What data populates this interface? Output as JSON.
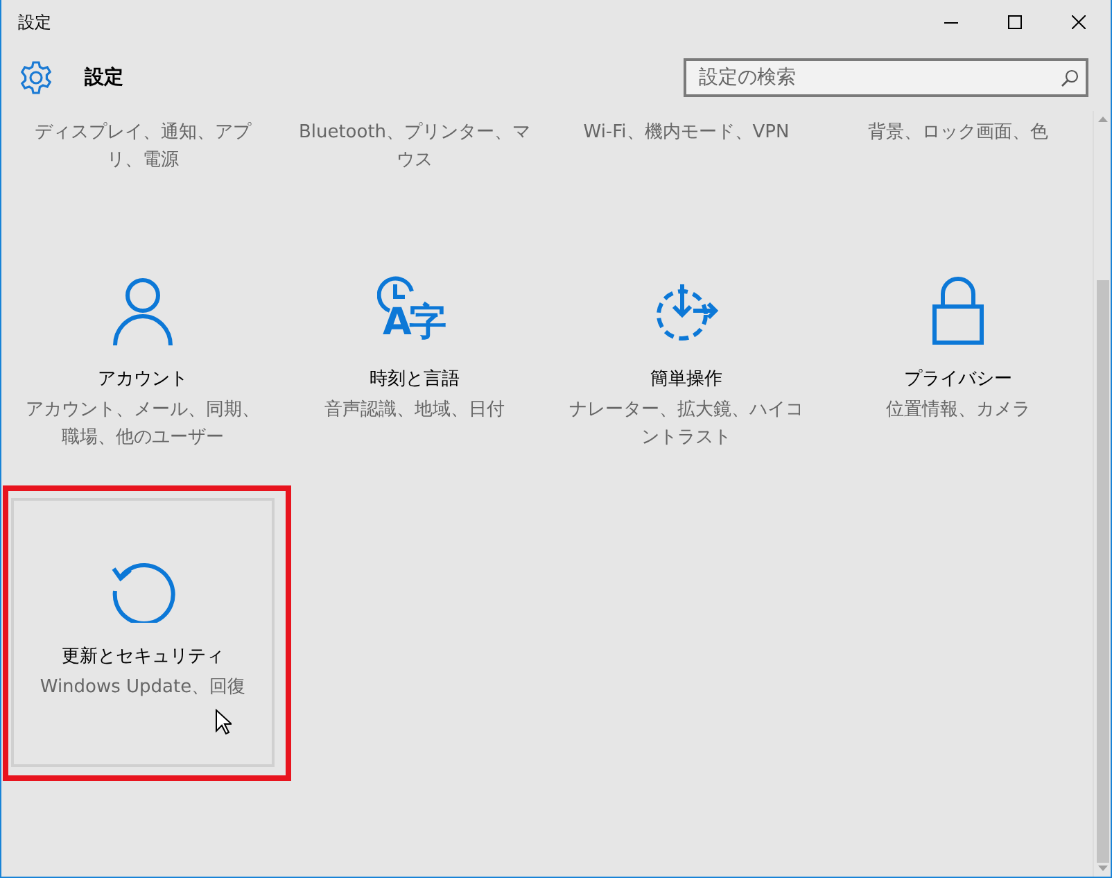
{
  "window": {
    "title": "設定"
  },
  "header": {
    "title": "設定",
    "search": {
      "placeholder": "設定の検索"
    }
  },
  "tiles": [
    {
      "description": "ディスプレイ、通知、アプリ、電源",
      "hovered": false
    },
    {
      "description": "Bluetooth、プリンター、マウス",
      "hovered": false
    },
    {
      "description": "Wi-Fi、機内モード、VPN",
      "hovered": false
    },
    {
      "description": "背景、ロック画面、色",
      "hovered": false
    },
    {
      "kind": "person",
      "title": "アカウント",
      "description": "アカウント、メール、同期、職場、他のユーザー",
      "hovered": false
    },
    {
      "kind": "clock-glyph",
      "icon_glyph": "A字",
      "title": "時刻と言語",
      "description": "音声認識、地域、日付",
      "hovered": false
    },
    {
      "kind": "dashed-circle",
      "title": "簡単操作",
      "description": "ナレーター、拡大鏡、ハイコントラスト",
      "hovered": false
    },
    {
      "kind": "lock",
      "title": "プライバシー",
      "description": "位置情報、カメラ",
      "hovered": false
    },
    {
      "kind": "refresh",
      "title": "更新とセキュリティ",
      "description": "Windows Update、回復",
      "hovered": true,
      "annotated": true
    }
  ]
}
